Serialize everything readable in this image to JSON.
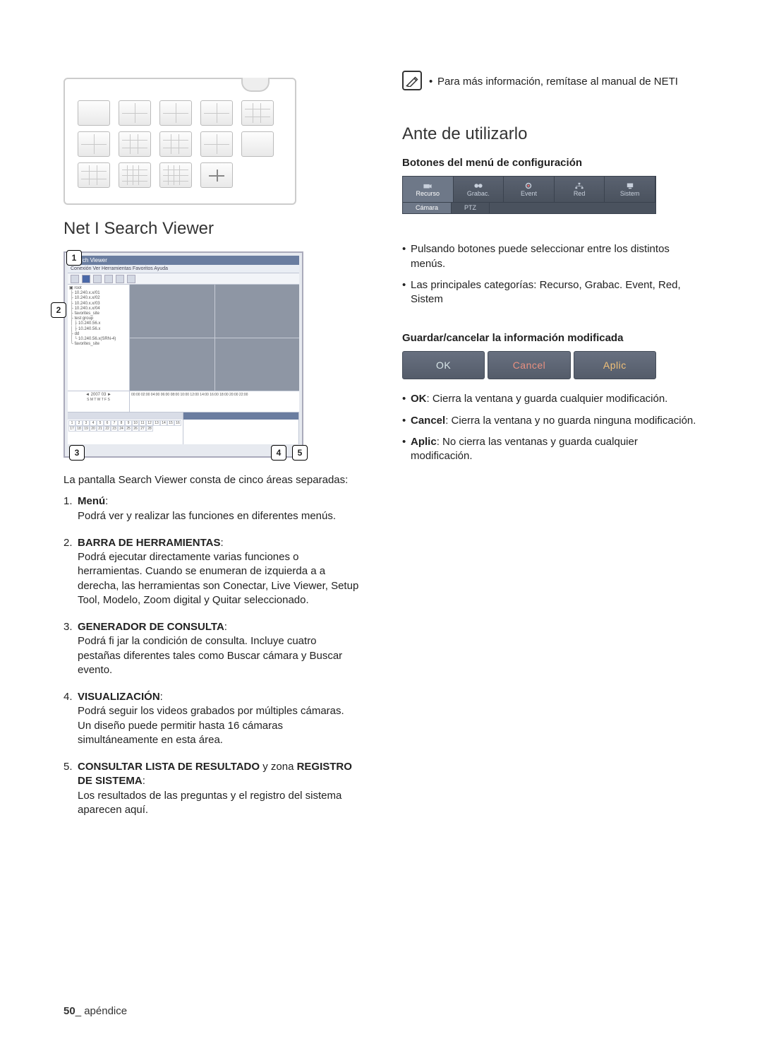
{
  "left": {
    "section_title": "Net I Search Viewer",
    "callouts": {
      "c1": "1",
      "c2": "2",
      "c3": "3",
      "c4": "4",
      "c5": "5"
    },
    "sv": {
      "title": "Search Viewer",
      "menu": "Conexión   Ver   Herramientas   Favoritos   Ayuda",
      "cal_header": "◄  2007  03  ►",
      "scale": "00:00  02:00  04:00  06:00  08:00  10:00  12:00  14:00  16:00  18:00  20:00  22:00"
    },
    "intro": "La pantalla Search Viewer consta de cinco áreas separadas:",
    "items": [
      {
        "num": "1.",
        "term": "Menú",
        "tail": ":",
        "desc": "Podrá ver y realizar las funciones en diferentes menús."
      },
      {
        "num": "2.",
        "term": "BARRA DE HERRAMIENTAS",
        "tail": ":",
        "desc": "Podrá ejecutar directamente varias funciones o herramientas. Cuando se enumeran de izquierda a a derecha, las herramientas son Conectar, Live Viewer, Setup Tool, Modelo, Zoom digital y Quitar seleccionado."
      },
      {
        "num": "3.",
        "term": "GENERADOR DE CONSULTA",
        "tail": ":",
        "desc": "Podrá fi jar la condición de consulta. Incluye cuatro pestañas diferentes tales como Buscar cámara y Buscar evento."
      },
      {
        "num": "4.",
        "term": "VISUALIZACIÓN",
        "tail": ":",
        "desc": "Podrá seguir los videos grabados por múltiples cámaras. Un diseño puede permitir hasta 16 cámaras simultáneamente en esta área."
      },
      {
        "num": "5.",
        "term": "CONSULTAR LISTA DE RESULTADO",
        "tail": " y zona ",
        "term2": "REGISTRO DE SISTEMA",
        "tail2": ":",
        "desc": "Los resultados de las preguntas y el registro del sistema aparecen aquí."
      }
    ]
  },
  "right": {
    "note": "Para más información, remítase al manual de NETI",
    "ante_title": "Ante de utilizarlo",
    "menu_heading": "Botones del menú de configuración",
    "menutabs": [
      "Recurso",
      "Grabac.",
      "Event",
      "Red",
      "Sistem"
    ],
    "subtabs": [
      "Cámara",
      "PTZ"
    ],
    "menu_bullets": [
      "Pulsando botones puede seleccionar entre los distintos menús.",
      "Las principales categorías: Recurso, Grabac. Event, Red, Sistem"
    ],
    "save_heading": "Guardar/cancelar la información modificada",
    "buttons": {
      "ok": "OK",
      "cancel": "Cancel",
      "aplic": "Aplic"
    },
    "save_bullets": [
      {
        "term": "OK",
        "text": ": Cierra la ventana y guarda cualquier modificación."
      },
      {
        "term": "Cancel",
        "text": ": Cierra la ventana y no guarda ninguna modificación."
      },
      {
        "term": "Aplic",
        "text": ": No cierra las ventanas y guarda cualquier modificación."
      }
    ]
  },
  "footer": {
    "page": "50",
    "sep": "_ ",
    "label": "apéndice"
  }
}
